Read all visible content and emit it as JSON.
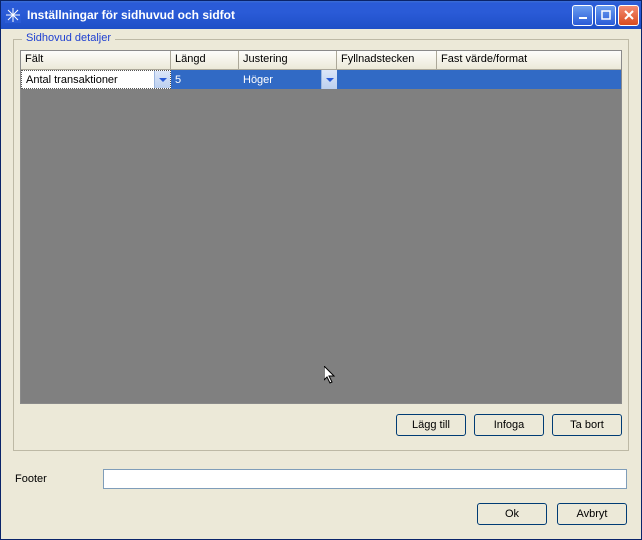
{
  "window": {
    "title": "Inställningar för sidhuvud och sidfot"
  },
  "group": {
    "title": "Sidhovud detaljer"
  },
  "columns": {
    "falt": "Fält",
    "langd": "Längd",
    "justering": "Justering",
    "fyllnadstecken": "Fyllnadstecken",
    "fast_varde": "Fast värde/format"
  },
  "row": {
    "falt": "Antal transaktioner",
    "langd": "5",
    "justering": "Höger",
    "fyllnadstecken": "",
    "fast_varde": ""
  },
  "buttons": {
    "add": "Lägg till",
    "insert": "Infoga",
    "delete": "Ta bort",
    "ok": "Ok",
    "cancel": "Avbryt"
  },
  "footer": {
    "label": "Footer",
    "value": ""
  }
}
